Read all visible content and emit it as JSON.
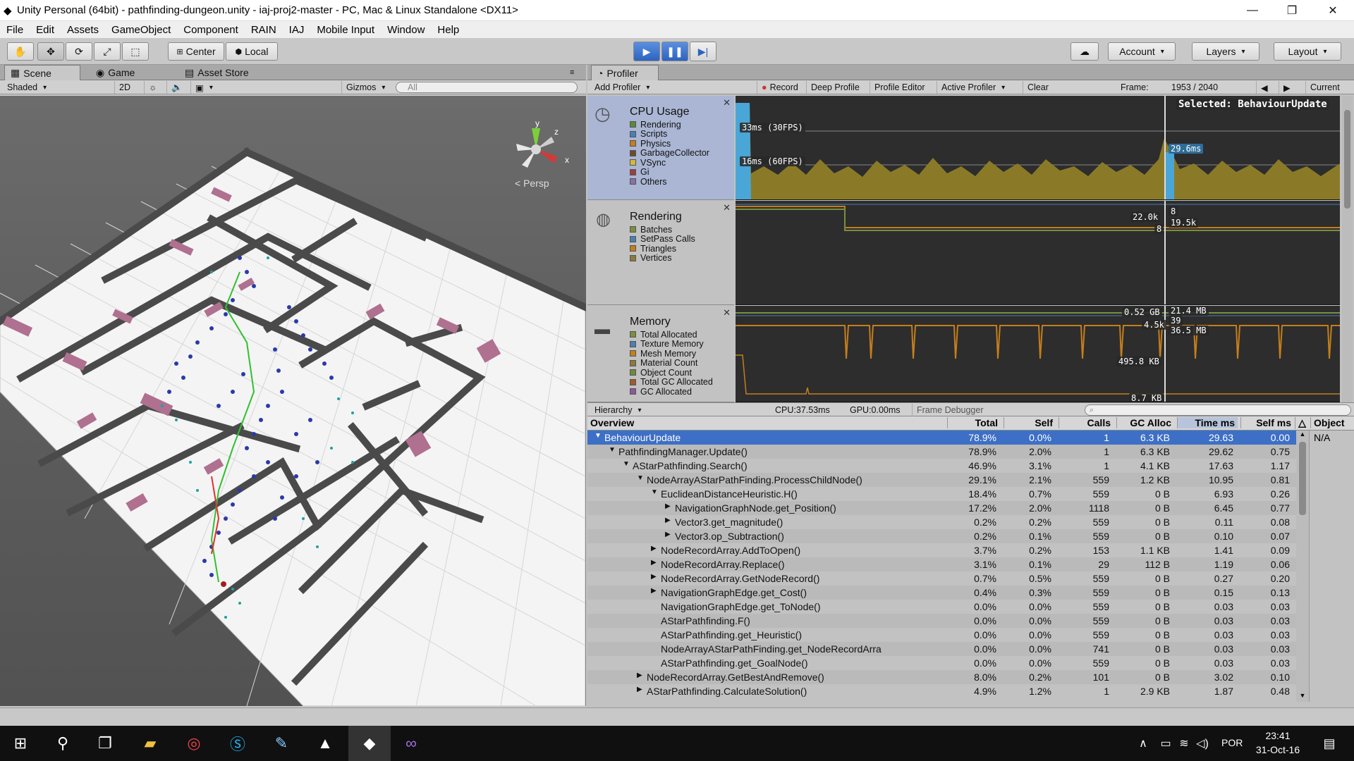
{
  "window": {
    "title": "Unity Personal (64bit) - pathfinding-dungeon.unity - iaj-proj2-master - PC, Mac & Linux Standalone <DX11>",
    "minimize": "—",
    "maximize": "❐",
    "close": "✕"
  },
  "menu": [
    "File",
    "Edit",
    "Assets",
    "GameObject",
    "Component",
    "RAIN",
    "IAJ",
    "Mobile Input",
    "Window",
    "Help"
  ],
  "toolbar": {
    "pivot": "Center",
    "space": "Local",
    "account": "Account",
    "layers": "Layers",
    "layout": "Layout"
  },
  "scene": {
    "tabs": [
      "Scene",
      "Game",
      "Asset Store"
    ],
    "shading": "Shaded",
    "mode_2d": "2D",
    "gizmos": "Gizmos",
    "search_placeholder": "All",
    "persp_label": "Persp",
    "axis_y": "y",
    "axis_z": "z",
    "axis_x": "x"
  },
  "profiler": {
    "tab": "Profiler",
    "add_profiler": "Add Profiler",
    "record": "Record",
    "deep_profile": "Deep Profile",
    "profiler_editor": "Profile Editor",
    "active_profiler": "Active Profiler",
    "clear": "Clear",
    "frame_label": "Frame:",
    "frame_value": "1953 / 2040",
    "current": "Current",
    "selected": "Selected: BehaviourUpdate",
    "cpu": {
      "name": "CPU Usage",
      "legend": [
        {
          "label": "Rendering",
          "color": "#5a8a3c"
        },
        {
          "label": "Scripts",
          "color": "#4a7fb5"
        },
        {
          "label": "Physics",
          "color": "#c47e1c"
        },
        {
          "label": "GarbageCollector",
          "color": "#6e4a2b"
        },
        {
          "label": "VSync",
          "color": "#d6b83a"
        },
        {
          "label": "Gi",
          "color": "#9c3f3f"
        },
        {
          "label": "Others",
          "color": "#8a6fa8"
        }
      ],
      "label_30fps": "33ms (30FPS)",
      "label_60fps": "16ms (60FPS)",
      "selected_value": "29.6ms"
    },
    "rendering": {
      "name": "Rendering",
      "legend": [
        {
          "label": "Batches",
          "color": "#7a8f3c"
        },
        {
          "label": "SetPass Calls",
          "color": "#4a7fb5"
        },
        {
          "label": "Triangles",
          "color": "#c47e1c"
        },
        {
          "label": "Vertices",
          "color": "#8a7a3a"
        }
      ],
      "val_a": "22.0k",
      "val_b": "8",
      "val_c": "8",
      "val_d": "19.5k"
    },
    "memory": {
      "name": "Memory",
      "legend": [
        {
          "label": "Total Allocated",
          "color": "#7a8f3c"
        },
        {
          "label": "Texture Memory",
          "color": "#4a7fb5"
        },
        {
          "label": "Mesh Memory",
          "color": "#c47e1c"
        },
        {
          "label": "Material Count",
          "color": "#8a7a3a"
        },
        {
          "label": "Object Count",
          "color": "#6f8a3c"
        },
        {
          "label": "Total GC Allocated",
          "color": "#a05a2c"
        },
        {
          "label": "GC Allocated",
          "color": "#8a5a9a"
        }
      ],
      "val_a": "0.52 GB",
      "val_b": "4.5k",
      "val_c": "495.8 KB",
      "val_d": "8.7 KB",
      "val_e": "21.4 MB",
      "val_f": "39",
      "val_g": "36.5 MB"
    },
    "hierarchy": "Hierarchy",
    "cpu_time": "CPU:37.53ms",
    "gpu_time": "GPU:0.00ms",
    "frame_debugger": "Frame Debugger",
    "columns": {
      "overview": "Overview",
      "total": "Total",
      "self": "Self",
      "calls": "Calls",
      "gc": "GC Alloc",
      "time": "Time ms",
      "selfms": "Self ms",
      "object": "Object",
      "object_value": "N/A"
    },
    "rows": [
      {
        "indent": 0,
        "arrow": "▼",
        "name": "BehaviourUpdate",
        "total": "78.9%",
        "self": "0.0%",
        "calls": "1",
        "gc": "6.3 KB",
        "time": "29.63",
        "selfms": "0.00"
      },
      {
        "indent": 1,
        "arrow": "▼",
        "name": "PathfindingManager.Update()",
        "total": "78.9%",
        "self": "2.0%",
        "calls": "1",
        "gc": "6.3 KB",
        "time": "29.62",
        "selfms": "0.75"
      },
      {
        "indent": 2,
        "arrow": "▼",
        "name": "AStarPathfinding.Search()",
        "total": "46.9%",
        "self": "3.1%",
        "calls": "1",
        "gc": "4.1 KB",
        "time": "17.63",
        "selfms": "1.17"
      },
      {
        "indent": 3,
        "arrow": "▼",
        "name": "NodeArrayAStarPathFinding.ProcessChildNode()",
        "total": "29.1%",
        "self": "2.1%",
        "calls": "559",
        "gc": "1.2 KB",
        "time": "10.95",
        "selfms": "0.81"
      },
      {
        "indent": 4,
        "arrow": "▼",
        "name": "EuclideanDistanceHeuristic.H()",
        "total": "18.4%",
        "self": "0.7%",
        "calls": "559",
        "gc": "0 B",
        "time": "6.93",
        "selfms": "0.26"
      },
      {
        "indent": 5,
        "arrow": "▶",
        "name": "NavigationGraphNode.get_Position()",
        "total": "17.2%",
        "self": "2.0%",
        "calls": "1118",
        "gc": "0 B",
        "time": "6.45",
        "selfms": "0.77"
      },
      {
        "indent": 5,
        "arrow": "▶",
        "name": "Vector3.get_magnitude()",
        "total": "0.2%",
        "self": "0.2%",
        "calls": "559",
        "gc": "0 B",
        "time": "0.11",
        "selfms": "0.08"
      },
      {
        "indent": 5,
        "arrow": "▶",
        "name": "Vector3.op_Subtraction()",
        "total": "0.2%",
        "self": "0.1%",
        "calls": "559",
        "gc": "0 B",
        "time": "0.10",
        "selfms": "0.07"
      },
      {
        "indent": 4,
        "arrow": "▶",
        "name": "NodeRecordArray.AddToOpen()",
        "total": "3.7%",
        "self": "0.2%",
        "calls": "153",
        "gc": "1.1 KB",
        "time": "1.41",
        "selfms": "0.09"
      },
      {
        "indent": 4,
        "arrow": "▶",
        "name": "NodeRecordArray.Replace()",
        "total": "3.1%",
        "self": "0.1%",
        "calls": "29",
        "gc": "112 B",
        "time": "1.19",
        "selfms": "0.06"
      },
      {
        "indent": 4,
        "arrow": "▶",
        "name": "NodeRecordArray.GetNodeRecord()",
        "total": "0.7%",
        "self": "0.5%",
        "calls": "559",
        "gc": "0 B",
        "time": "0.27",
        "selfms": "0.20"
      },
      {
        "indent": 4,
        "arrow": "▶",
        "name": "NavigationGraphEdge.get_Cost()",
        "total": "0.4%",
        "self": "0.3%",
        "calls": "559",
        "gc": "0 B",
        "time": "0.15",
        "selfms": "0.13"
      },
      {
        "indent": 4,
        "arrow": "",
        "name": "NavigationGraphEdge.get_ToNode()",
        "total": "0.0%",
        "self": "0.0%",
        "calls": "559",
        "gc": "0 B",
        "time": "0.03",
        "selfms": "0.03"
      },
      {
        "indent": 4,
        "arrow": "",
        "name": "AStarPathfinding.F()",
        "total": "0.0%",
        "self": "0.0%",
        "calls": "559",
        "gc": "0 B",
        "time": "0.03",
        "selfms": "0.03"
      },
      {
        "indent": 4,
        "arrow": "",
        "name": "AStarPathfinding.get_Heuristic()",
        "total": "0.0%",
        "self": "0.0%",
        "calls": "559",
        "gc": "0 B",
        "time": "0.03",
        "selfms": "0.03"
      },
      {
        "indent": 4,
        "arrow": "",
        "name": "NodeArrayAStarPathFinding.get_NodeRecordArra",
        "total": "0.0%",
        "self": "0.0%",
        "calls": "741",
        "gc": "0 B",
        "time": "0.03",
        "selfms": "0.03"
      },
      {
        "indent": 4,
        "arrow": "",
        "name": "AStarPathfinding.get_GoalNode()",
        "total": "0.0%",
        "self": "0.0%",
        "calls": "559",
        "gc": "0 B",
        "time": "0.03",
        "selfms": "0.03"
      },
      {
        "indent": 3,
        "arrow": "▶",
        "name": "NodeRecordArray.GetBestAndRemove()",
        "total": "8.0%",
        "self": "0.2%",
        "calls": "101",
        "gc": "0 B",
        "time": "3.02",
        "selfms": "0.10"
      },
      {
        "indent": 3,
        "arrow": "▶",
        "name": "AStarPathfinding.CalculateSolution()",
        "total": "4.9%",
        "self": "1.2%",
        "calls": "1",
        "gc": "2.9 KB",
        "time": "1.87",
        "selfms": "0.48"
      }
    ]
  },
  "taskbar": {
    "language": "POR",
    "time": "23:41",
    "date": "31-Oct-16"
  }
}
